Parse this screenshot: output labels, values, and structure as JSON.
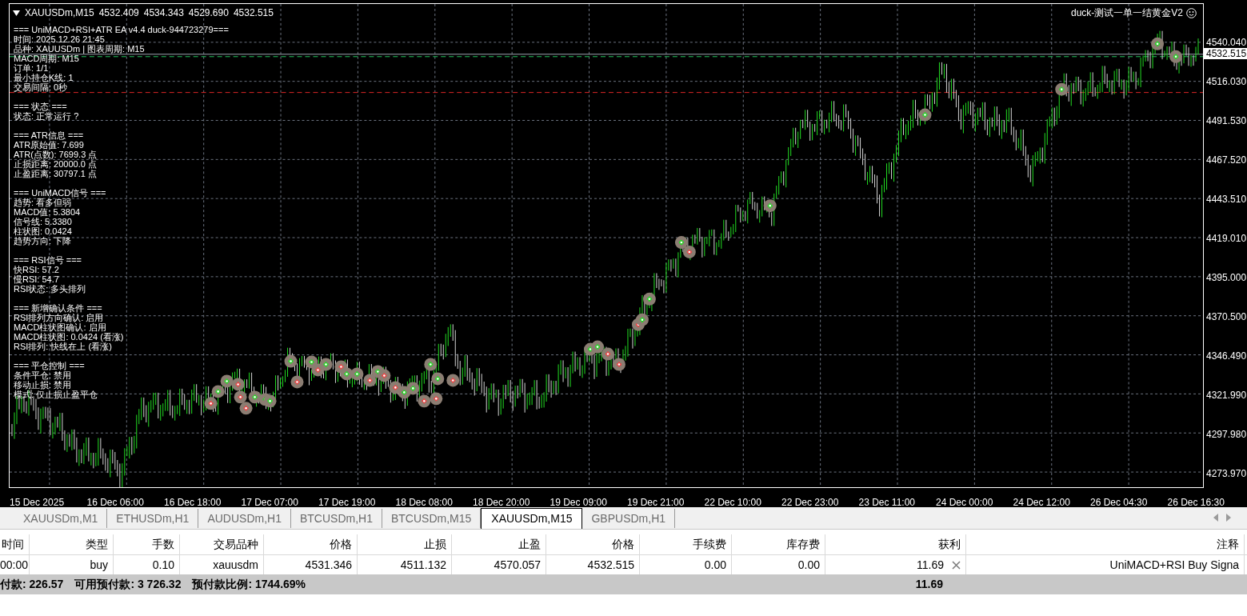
{
  "chart": {
    "header": {
      "symbol": "XAUUSDm,M15",
      "ohlc": [
        "4532.409",
        "4534.343",
        "4529.690",
        "4532.515"
      ]
    },
    "ea_title": "duck-测试一单一结黄金V2",
    "info_panel": [
      {
        "header": "=== UniMACD+RSI+ATR EA v4.4 duck-944723279===",
        "lines": [
          "时间: 2025.12.26 21:45",
          "品种: XAUUSDm | 图表周期: M15",
          "MACD周期: M15",
          "订单: 1/1",
          "最小持仓K线: 1",
          "交易间隔: 0秒"
        ]
      },
      {
        "header": "=== 状态 ===",
        "lines": [
          "状态: 正常运行 ?"
        ]
      },
      {
        "header": "=== ATR信息 ===",
        "lines": [
          "ATR原始值: 7.699",
          "ATR(点数): 7699.3 点",
          "止损距离: 20000.0 点",
          "止盈距离: 30797.1 点"
        ]
      },
      {
        "header": "=== UniMACD信号 ===",
        "lines": [
          "趋势: 看多但弱",
          "MACD值: 5.3804",
          "信号线: 5.3380",
          "柱状图: 0.0424",
          "趋势方向: 下降"
        ]
      },
      {
        "header": "=== RSI信号 ===",
        "lines": [
          "快RSI: 57.2",
          "慢RSI: 54.7",
          "RSI状态: 多头排列"
        ]
      },
      {
        "header": "=== 新增确认条件 ===",
        "lines": [
          "RSI排列方向确认: 启用",
          "MACD柱状图确认: 启用",
          "MACD柱状图: 0.0424 (看涨)",
          "RSI排列: 快线在上 (看涨)"
        ]
      },
      {
        "header": "=== 平仓控制 ===",
        "lines": [
          "条件平仓: 禁用",
          "移动止损: 禁用",
          "模式: 仅止损止盈平仓"
        ]
      }
    ],
    "price_axis": [
      "4540.040",
      "4516.030",
      "4491.530",
      "4467.520",
      "4443.510",
      "4419.010",
      "4395.000",
      "4370.500",
      "4346.490",
      "4321.990",
      "4297.980",
      "4273.970"
    ],
    "current_price": "4532.515",
    "time_axis": [
      "15 Dec 2025",
      "16 Dec 06:00",
      "16 Dec 18:00",
      "17 Dec 07:00",
      "17 Dec 19:00",
      "18 Dec 08:00",
      "18 Dec 20:00",
      "19 Dec 09:00",
      "19 Dec 21:00",
      "22 Dec 10:00",
      "22 Dec 23:00",
      "23 Dec 11:00",
      "24 Dec 00:00",
      "24 Dec 12:00",
      "26 Dec 04:30",
      "26 Dec 16:30"
    ]
  },
  "tabs": [
    {
      "label": "XAUUSDm,M1",
      "selected": false
    },
    {
      "label": "ETHUSDm,H1",
      "selected": false
    },
    {
      "label": "AUDUSDm,H1",
      "selected": false
    },
    {
      "label": "BTCUSDm,H1",
      "selected": false
    },
    {
      "label": "BTCUSDm,M15",
      "selected": false
    },
    {
      "label": "XAUUSDm,M15",
      "selected": true
    },
    {
      "label": "GBPUSDm,H1",
      "selected": false
    }
  ],
  "positions": {
    "columns": [
      "时间",
      "类型",
      "手数",
      "交易品种",
      "价格",
      "止损",
      "止盈",
      "价格",
      "手续费",
      "库存费",
      "获利",
      "注释"
    ],
    "rows": [
      {
        "cells": [
          "00:00",
          "buy",
          "0.10",
          "xauusdm",
          "4531.346",
          "4511.132",
          "4570.057",
          "4532.515",
          "0.00",
          "0.00",
          "11.69",
          "UniMACD+RSI Buy Signa"
        ]
      }
    ],
    "summary": {
      "account": [
        "付款: 226.57",
        "可用预付款: 3 726.32",
        "预付款比例: 1744.69%"
      ],
      "profit": "11.69"
    }
  }
}
